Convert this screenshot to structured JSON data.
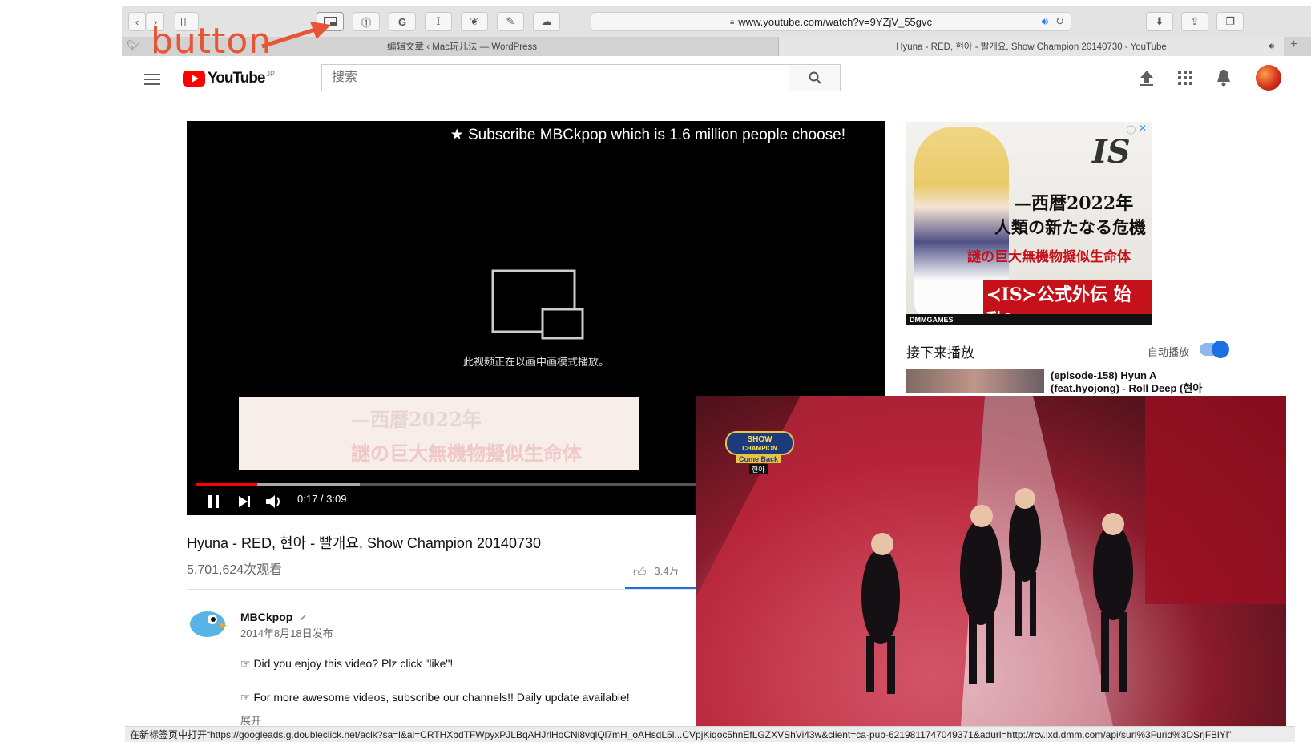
{
  "browser": {
    "url": "www.youtube.com/watch?v=9YZjV_55gvc",
    "tabs": [
      {
        "title": "编辑文章 ‹ Mac玩儿法 — WordPress"
      },
      {
        "title": "Hyuna - RED, 현아 - 빨개요, Show Champion 20140730 - YouTube"
      }
    ],
    "extension_icons": [
      "picture-in-picture-icon",
      "1password-icon",
      "grammarly-icon",
      "instapaper-icon",
      "evernote-icon",
      "tools-icon",
      "pocket-icon"
    ]
  },
  "annotation": {
    "label": "button",
    "color": "#e85535"
  },
  "youtube": {
    "logo_text": "YouTube",
    "region": "JP",
    "search_placeholder": "搜索"
  },
  "player": {
    "banner": "★ Subscribe MBCkpop which is 1.6 million people choose!",
    "pip_message": "此视频正在以画中画模式播放。",
    "time": "0:17 / 3:09",
    "progress": 0.09,
    "buffered": 0.24,
    "accent": "#ff0000"
  },
  "ad": {
    "line1": "—西暦2022年",
    "line2": "人類の新たなる危機",
    "line3": "謎の巨大無機物擬似生命体",
    "line4": "≺IS≻公式外伝 始動!",
    "brand": "DMMGAMES"
  },
  "upnext": {
    "heading": "接下来播放",
    "autoplay_label": "自动播放",
    "autoplay_on": true,
    "item_title": "(episode-158) Hyun A (feat.hyojong) - Roll Deep (현아"
  },
  "video": {
    "title": "Hyuna - RED, 현아 - 빨개요, Show Champion 20140730",
    "views": "5,701,624次观看",
    "likes": "3.4万"
  },
  "channel": {
    "name": "MBCkpop",
    "published": "2014年8月18日发布",
    "desc1": "☞ Did you enjoy this video? Plz click \"like\"!",
    "desc2": "☞ For more awesome videos, subscribe our channels!! Daily update available!",
    "expand": "展开"
  },
  "pip": {
    "logo_line1": "SHOW",
    "logo_line2": "CHAMPION",
    "logo_line3": "Come Back",
    "logo_line4": "현아"
  },
  "status_bar": "在新标签页中打开“https://googleads.g.doubleclick.net/aclk?sa=l&ai=CRTHXbdTFWpyxPJLBqAHJrlHoCNi8vqlQl7mH_oAHsdL5l...CVpjKiqoc5hnEfLGZXVShVi43w&client=ca-pub-6219811747049371&adurl=http://rcv.ixd.dmm.com/api/surl%3Furid%3DSrjFBlYl”"
}
